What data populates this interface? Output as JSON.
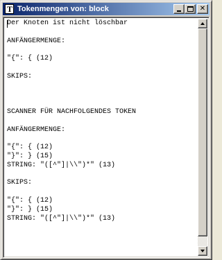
{
  "window": {
    "title": "Tokenmengen von: block",
    "icon": "text-document-t-icon"
  },
  "caption_buttons": {
    "minimize": "minimize-icon",
    "maximize": "maximize-icon",
    "close": "close-icon"
  },
  "content": {
    "lines": [
      "Der Knoten ist nicht löschbar",
      "",
      "ANFÄNGERMENGE:",
      "",
      "\"{\": { (12)",
      "",
      "SKIPS:",
      "",
      "",
      "",
      "SCANNER FÜR NACHFOLGENDES TOKEN",
      "",
      "ANFÄNGERMENGE:",
      "",
      "\"{\": { (12)",
      "\"}\": } (15)",
      "STRING: \"([^\"]|\\\\\")*\" (13)",
      "",
      "SKIPS:",
      "",
      "\"{\": { (12)",
      "\"}\": } (15)",
      "STRING: \"([^\"]|\\\\\")*\" (13)"
    ]
  },
  "colors": {
    "titlebar_start": "#0a246a",
    "titlebar_end": "#a6caf0",
    "face": "#d4d0c8"
  }
}
